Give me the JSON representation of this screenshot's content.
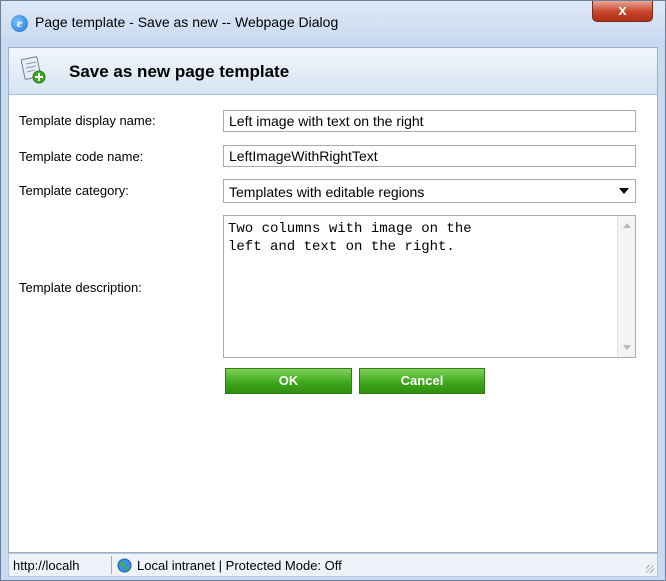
{
  "window": {
    "title": "Page template - Save as new -- Webpage Dialog",
    "close_label": "x"
  },
  "header": {
    "title": "Save as new page template",
    "icon": "document-add-icon"
  },
  "form": {
    "display_name": {
      "label": "Template display name:",
      "value": "Left image with text on the right"
    },
    "code_name": {
      "label": "Template code name:",
      "value": "LeftImageWithRightText"
    },
    "category": {
      "label": "Template category:",
      "value": "Templates with editable regions"
    },
    "description": {
      "label": "Template description:",
      "value": "Two columns with image on the\nleft and text on the right."
    }
  },
  "buttons": {
    "ok": "OK",
    "cancel": "Cancel"
  },
  "colors": {
    "button_green": "#3fa81b",
    "title_bar": "#c6d8f0",
    "header_bg": "#d7e4f3"
  },
  "statusbar": {
    "url": "http://localh",
    "zone": "Local intranet | Protected Mode: Off",
    "zone_icon": "globe-icon"
  }
}
